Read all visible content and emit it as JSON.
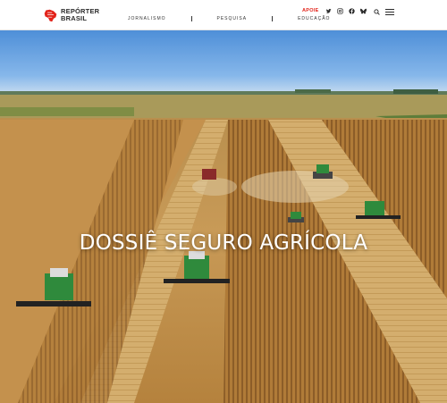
{
  "header": {
    "logo": {
      "line1": "REPÓRTER",
      "line2": "BRASIL"
    },
    "nav": [
      {
        "label": "JORNALISMO"
      },
      {
        "label": "PESQUISA"
      },
      {
        "label": "EDUCAÇÃO"
      }
    ],
    "support_label": "APOIE",
    "social_icons": [
      "twitter-icon",
      "instagram-icon",
      "facebook-icon",
      "bluesky-icon"
    ],
    "search_icon": "search-icon",
    "menu_icon": "hamburger-menu-icon"
  },
  "hero": {
    "title": "DOSSIÊ SEGURO AGRÍCOLA",
    "image": "aerial-photo-combine-harvesters-in-soy-field"
  },
  "colors": {
    "brand_red": "#e2231a",
    "text_dark": "#2b2b2b"
  }
}
